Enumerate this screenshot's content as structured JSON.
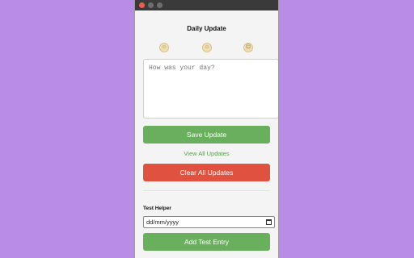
{
  "app": {
    "title": "Daily Update"
  },
  "moods": [
    {
      "icon": "happy-face-icon",
      "glyph": "☺"
    },
    {
      "icon": "neutral-face-icon",
      "glyph": "☺"
    },
    {
      "icon": "sad-face-icon",
      "glyph": "☹"
    }
  ],
  "editor": {
    "placeholder": "How was your day?"
  },
  "actions": {
    "save_label": "Save Update",
    "view_all_label": "View All Updates",
    "clear_label": "Clear All Updates"
  },
  "test_helper": {
    "label": "Test Helper",
    "date_placeholder": "dd/mm/yyyy",
    "add_label": "Add Test Entry"
  },
  "colors": {
    "background": "#b98ce8",
    "panel": "#f4f4f4",
    "primary": "#6aaf5e",
    "danger": "#e15140",
    "link": "#5a9f4e"
  }
}
